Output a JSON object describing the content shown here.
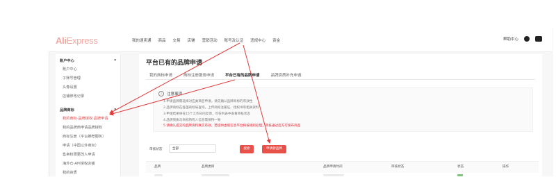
{
  "logo": {
    "brand": "AliExpress",
    "main": "Ali",
    "rest": "Express"
  },
  "nav": [
    "我的速卖通",
    "商品",
    "交易",
    "店铺",
    "营销活动",
    "账号及认证",
    "违规中心",
    "资金"
  ],
  "topright": {
    "label": "帮助中心"
  },
  "sidebar": {
    "groups": [
      {
        "title": "账户中心",
        "items": [
          "账户中心",
          "子账号管理",
          "头像设置",
          "店铺修改记录"
        ]
      },
      {
        "title": "品牌商标",
        "items": [
          "我的商标·品牌授权·品牌申请",
          "我的品牌商申请品牌授权",
          "商标注册（平台推荐服务）",
          "申请（中国以外商标）",
          "售卖权限更改人申请",
          "海外仓-API授权店铺",
          "我的资质"
        ]
      }
    ],
    "active": "我的商标·品牌授权·品牌申请"
  },
  "page": {
    "title": "平台已有的品牌申请"
  },
  "tabs": [
    "我的商标申请",
    "商标注册服务申请",
    "平台已有的品牌申请",
    "品牌资质补充申请"
  ],
  "active_tab": "平台已有的品牌申请",
  "notice": {
    "title": "注意事项",
    "lines": [
      "1.申请品牌需选择对应类目后申请，请先确认品牌商标的有效性",
      "2.品牌商标在各国商标局查询，上传商标注册证、授权书等相关资料",
      "3.申请结果将在15个工作日内反馈，可在列表中查看审核状态",
      "4.品牌资质与商标持有人信息需保持一致",
      "5.请确认提交的品牌资料真实有效，若提供虚假信息平台将按规则处理，审核通过后方可发布商品"
    ]
  },
  "filter": {
    "label": "审核状态",
    "value": "全部"
  },
  "buttons": {
    "search": "搜索",
    "apply": "申请新品牌"
  },
  "table": {
    "headers": [
      "品牌",
      "品牌类目",
      "品牌申请时间",
      "审核状态",
      "状态",
      "操作"
    ]
  }
}
